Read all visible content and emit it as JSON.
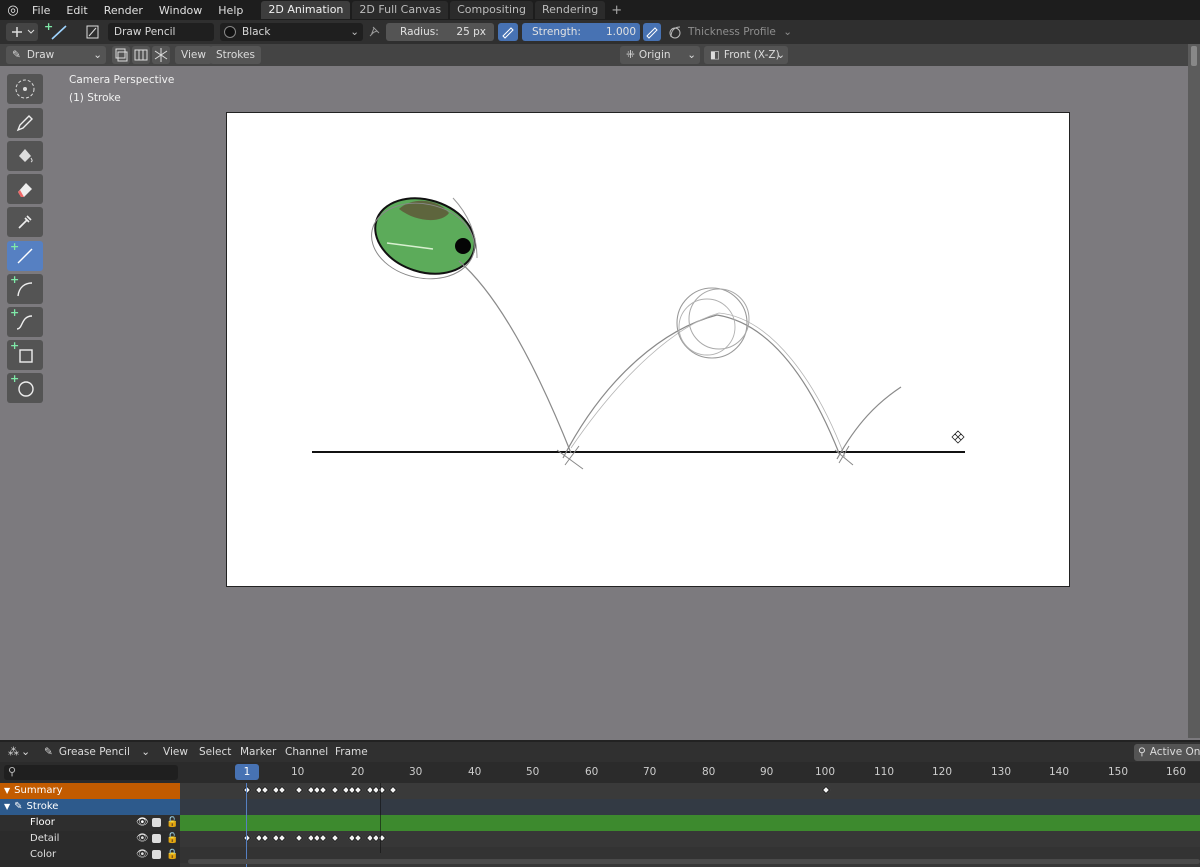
{
  "topbar": {
    "menus": [
      "File",
      "Edit",
      "Render",
      "Window",
      "Help"
    ],
    "tabs": [
      {
        "label": "2D Animation",
        "active": true
      },
      {
        "label": "2D Full Canvas",
        "active": false
      },
      {
        "label": "Compositing",
        "active": false
      },
      {
        "label": "Rendering",
        "active": false
      }
    ],
    "add_tab": "+"
  },
  "tool_settings": {
    "brush_name": "Draw Pencil",
    "material": "Black",
    "radius_label": "Radius:",
    "radius_value": "25 px",
    "strength_label": "Strength:",
    "strength_value": "1.000",
    "thickness_profile": "Thickness Profile"
  },
  "header": {
    "mode": "Draw",
    "view": "View",
    "strokes": "Strokes",
    "origin": "Origin",
    "orientation": "Front (X-Z)"
  },
  "viewport": {
    "camera_label": "Camera Perspective",
    "object_label": "(1) Stroke"
  },
  "dopesheet": {
    "editor": "Grease Pencil",
    "menus": [
      "View",
      "Select",
      "Marker",
      "Channel",
      "Frame"
    ],
    "active_only": "Active On",
    "current_frame": "1",
    "ruler": [
      "10",
      "20",
      "30",
      "40",
      "50",
      "60",
      "70",
      "80",
      "90",
      "100",
      "110",
      "120",
      "130",
      "140",
      "150",
      "160"
    ],
    "channels": {
      "summary": "Summary",
      "object": "Stroke",
      "layers": [
        "Floor",
        "Detail",
        "Color"
      ]
    }
  },
  "colors": {
    "accent": "#4772b3",
    "summary_row": "#c25b00",
    "object_row": "#2d5a8c",
    "layer_highlight": "#3d8a2e",
    "ball_fill": "#5cab5a"
  }
}
